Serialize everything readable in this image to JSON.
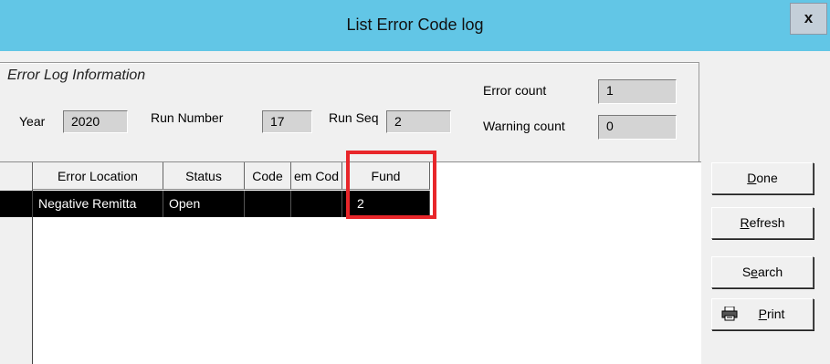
{
  "window": {
    "title": "List Error Code log",
    "close_label": "x"
  },
  "group": {
    "caption": "Error Log Information",
    "year_label": "Year",
    "year_value": "2020",
    "run_number_label": "Run Number",
    "run_number_value": "17",
    "run_seq_label": "Run Seq",
    "run_seq_value": "2",
    "error_count_label": "Error count",
    "error_count_value": "1",
    "warning_count_label": "Warning count",
    "warning_count_value": "0"
  },
  "grid": {
    "columns": [
      "Error Location",
      "Status",
      "Code",
      "em Cod",
      "Fund"
    ],
    "rows": [
      [
        "Negative Remitta",
        "Open",
        "",
        "",
        "2"
      ]
    ]
  },
  "buttons": {
    "done": {
      "prefix": "",
      "accel": "D",
      "suffix": "one"
    },
    "refresh": {
      "prefix": "",
      "accel": "R",
      "suffix": "efresh"
    },
    "search": {
      "prefix": "S",
      "accel": "e",
      "suffix": "arch"
    },
    "print": {
      "prefix": "",
      "accel": "P",
      "suffix": "rint"
    }
  },
  "icons": {
    "print": "printer-icon"
  },
  "colors": {
    "titlebar": "#62c6e6",
    "highlight": "#e8262a",
    "selected_row": "#000000"
  }
}
